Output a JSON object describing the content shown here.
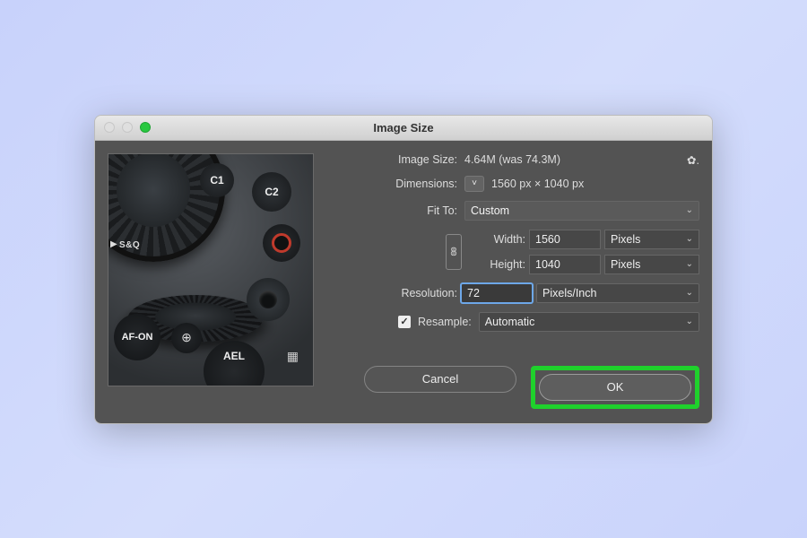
{
  "window": {
    "title": "Image Size"
  },
  "preview_labels": {
    "c1": "C1",
    "c2": "C2",
    "afon": "AF-ON",
    "mag": "⊕",
    "ael": "AEL",
    "mode": "S&Q"
  },
  "info": {
    "image_size_label": "Image Size:",
    "image_size_value": "4.64M (was 74.3M)",
    "dimensions_label": "Dimensions:",
    "dimensions_value": "1560 px × 1040 px"
  },
  "fields": {
    "fit_to": {
      "label": "Fit To:",
      "value": "Custom"
    },
    "width": {
      "label": "Width:",
      "value": "1560",
      "unit": "Pixels"
    },
    "height": {
      "label": "Height:",
      "value": "1040",
      "unit": "Pixels"
    },
    "resolution": {
      "label": "Resolution:",
      "value": "72",
      "unit": "Pixels/Inch"
    },
    "resample": {
      "label": "Resample:",
      "checked": true,
      "method": "Automatic"
    }
  },
  "buttons": {
    "cancel": "Cancel",
    "ok": "OK"
  },
  "colors": {
    "highlight": "#1fd12c",
    "panel": "#535353",
    "focus": "#6da7e8"
  }
}
